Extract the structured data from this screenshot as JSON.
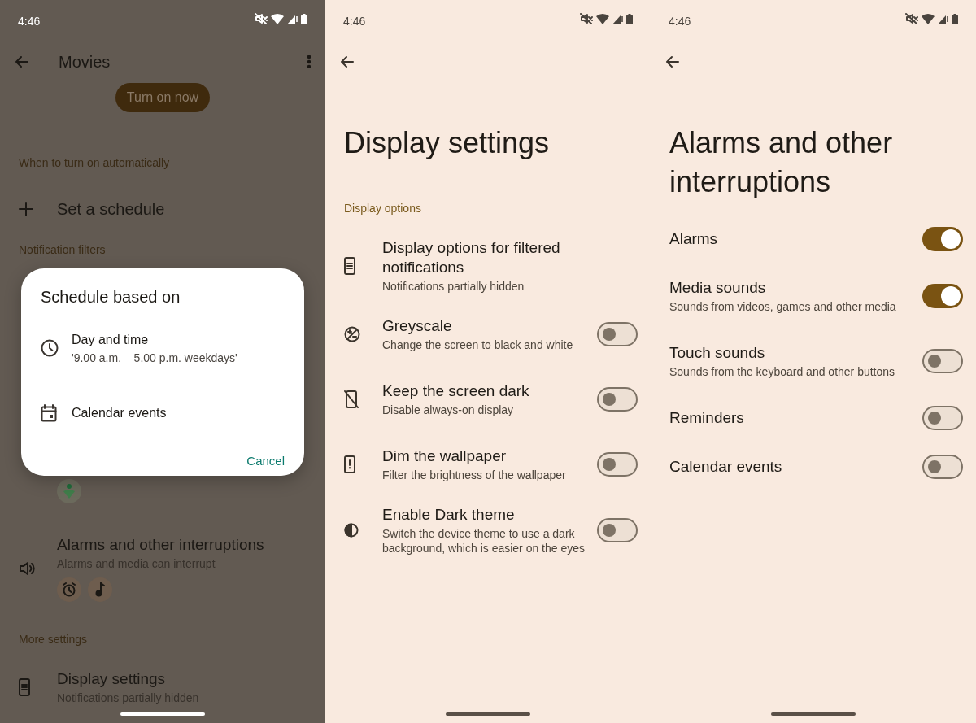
{
  "panels": [
    {
      "kind": "mode",
      "dimmed": true,
      "status_bar": {
        "time": "4:46"
      },
      "title": "Movies",
      "primary_button": "Turn on now",
      "sections": [
        {
          "header": "When to turn on automatically",
          "rows": [
            {
              "kind": "add",
              "title": "Set a schedule"
            }
          ]
        },
        {
          "header": "Notification filters",
          "rows": [
            {
              "kind": "covered"
            },
            {
              "kind": "people"
            },
            {
              "kind": "chips",
              "title": "Alarms and other interruptions",
              "subtitle": "Alarms and media can interrupt"
            }
          ]
        },
        {
          "header": "More settings",
          "rows": [
            {
              "kind": "link",
              "title": "Display settings",
              "subtitle": "Notifications partially hidden"
            }
          ]
        }
      ],
      "dialog": {
        "title": "Schedule based on",
        "options": [
          {
            "label": "Day and time",
            "detail": "'9.00 a.m. – 5.00 p.m. weekdays'"
          },
          {
            "label": "Calendar events"
          }
        ],
        "cancel": "Cancel"
      }
    },
    {
      "kind": "settings",
      "dimmed": false,
      "status_bar": {
        "time": "4:46"
      },
      "title": "Display settings",
      "sections": [
        {
          "header": "Display options",
          "rows": [
            {
              "kind": "link",
              "title": "Display options for filtered notifications",
              "subtitle": "Notifications partially hidden"
            },
            {
              "kind": "toggle",
              "title": "Greyscale",
              "subtitle": "Change the screen to black and white",
              "on": false
            },
            {
              "kind": "toggle",
              "title": "Keep the screen dark",
              "subtitle": "Disable always-on display",
              "on": false
            },
            {
              "kind": "toggle",
              "title": "Dim the wallpaper",
              "subtitle": "Filter the brightness of the wallpaper",
              "on": false
            },
            {
              "kind": "toggle",
              "title": "Enable Dark theme",
              "subtitle": "Switch the device theme to use a dark background, which is easier on the eyes",
              "on": false
            }
          ]
        }
      ]
    },
    {
      "kind": "settings",
      "dimmed": false,
      "status_bar": {
        "time": "4:46"
      },
      "title": "Alarms and other interruptions",
      "sections": [
        {
          "rows": [
            {
              "kind": "toggle",
              "title": "Alarms",
              "on": true
            },
            {
              "kind": "toggle",
              "title": "Media sounds",
              "subtitle": "Sounds from videos, games and other media",
              "on": true
            },
            {
              "kind": "toggle",
              "title": "Touch sounds",
              "subtitle": "Sounds from the keyboard and other buttons",
              "on": false
            },
            {
              "kind": "toggle",
              "title": "Reminders",
              "on": false
            },
            {
              "kind": "toggle",
              "title": "Calendar events",
              "on": false
            }
          ]
        }
      ]
    }
  ]
}
